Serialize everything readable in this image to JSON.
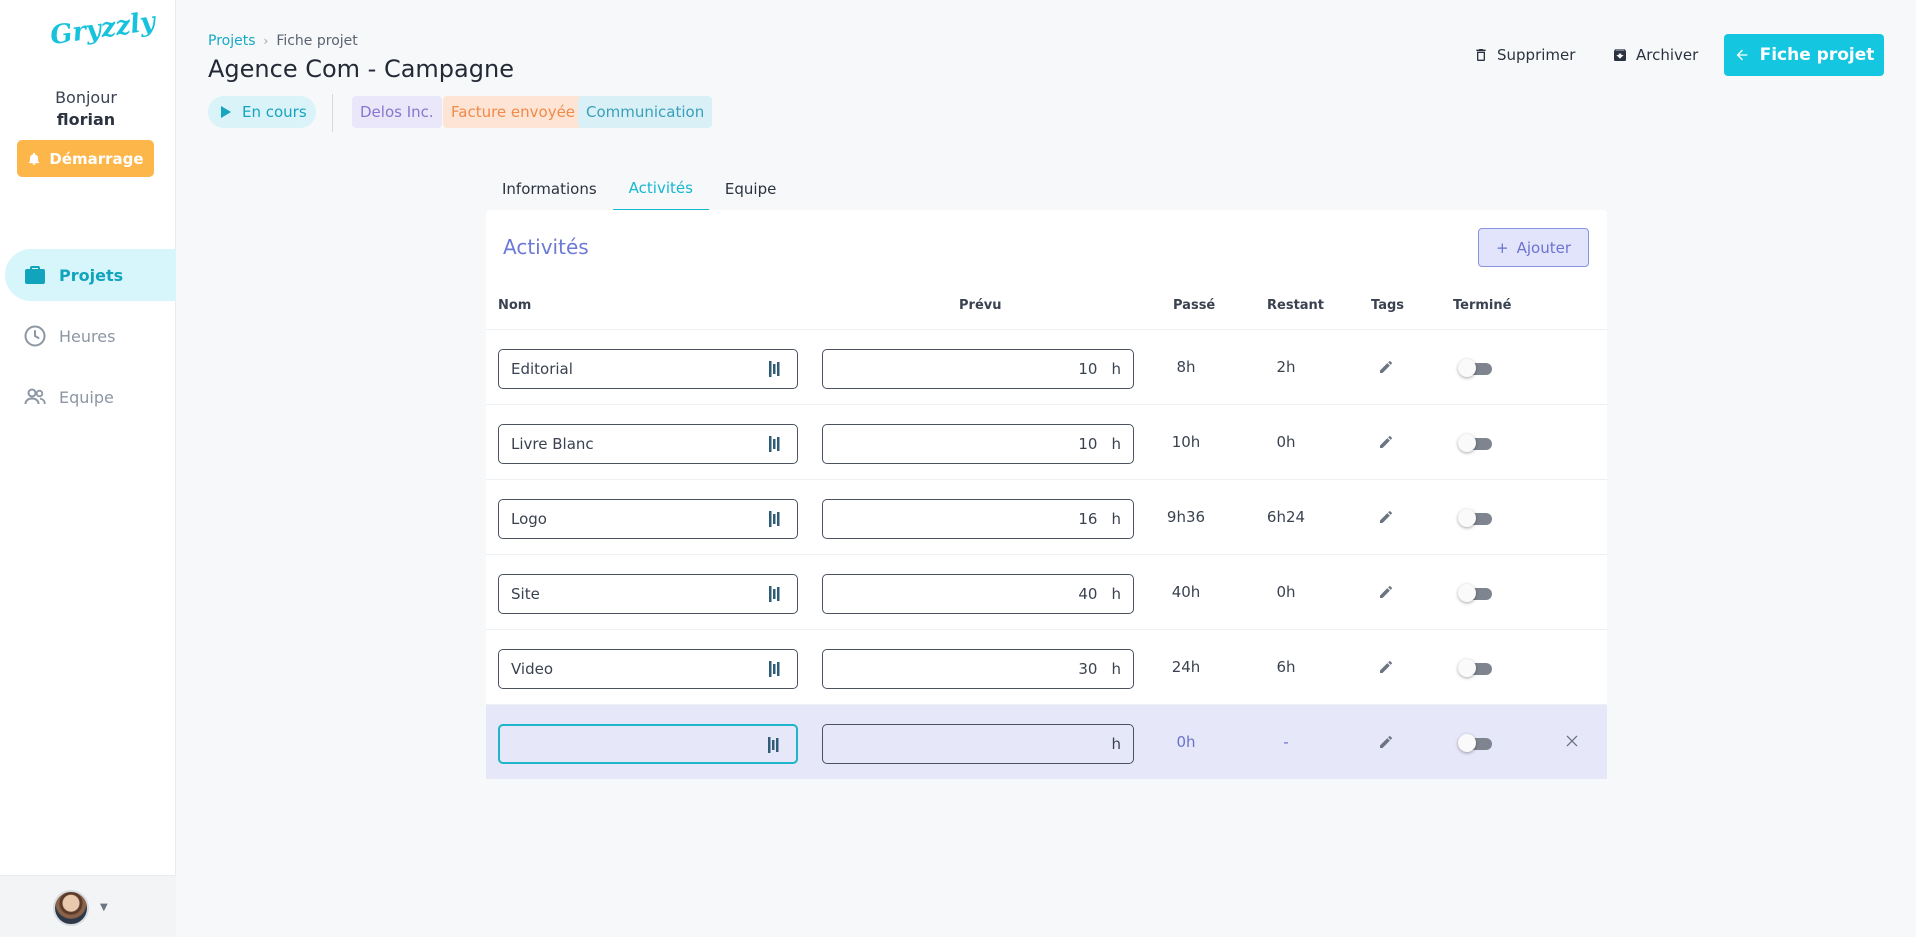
{
  "app": {
    "logo_text": "Gryzzly"
  },
  "sidebar": {
    "greeting": "Bonjour",
    "username": "florian",
    "start_button": "Démarrage",
    "items": [
      {
        "label": "Projets",
        "icon": "briefcase-icon",
        "active": true
      },
      {
        "label": "Heures",
        "icon": "clock-icon",
        "active": false
      },
      {
        "label": "Equipe",
        "icon": "people-icon",
        "active": false
      }
    ]
  },
  "breadcrumb": {
    "parent": "Projets",
    "current": "Fiche projet"
  },
  "project": {
    "title": "Agence Com - Campagne",
    "status": "En cours",
    "tags": [
      "Delos Inc.",
      "Facture envoyée",
      "Communication"
    ]
  },
  "header_actions": {
    "delete": "Supprimer",
    "archive": "Archiver",
    "back": "Fiche projet"
  },
  "tabs": [
    {
      "label": "Informations",
      "active": false
    },
    {
      "label": "Activités",
      "active": true
    },
    {
      "label": "Equipe",
      "active": false
    }
  ],
  "activities": {
    "title": "Activités",
    "add_button": "Ajouter",
    "columns": {
      "name": "Nom",
      "prevu": "Prévu",
      "passe": "Passé",
      "restant": "Restant",
      "tags": "Tags",
      "termine": "Terminé"
    },
    "unit": "h",
    "rows": [
      {
        "name": "Editorial",
        "prevu": "10",
        "passe": "8h",
        "restant": "2h",
        "done": false
      },
      {
        "name": "Livre Blanc",
        "prevu": "10",
        "passe": "10h",
        "restant": "0h",
        "done": false
      },
      {
        "name": "Logo",
        "prevu": "16",
        "passe": "9h36",
        "restant": "6h24",
        "done": false
      },
      {
        "name": "Site",
        "prevu": "40",
        "passe": "40h",
        "restant": "0h",
        "done": false
      },
      {
        "name": "Video",
        "prevu": "30",
        "passe": "24h",
        "restant": "6h",
        "done": false
      }
    ],
    "new_row": {
      "name": "",
      "prevu": "",
      "passe": "0h",
      "restant": "-",
      "done": false
    }
  },
  "colors": {
    "accent": "#15c6e1",
    "start": "#fdb64a",
    "violet": "#6c7ad6"
  }
}
